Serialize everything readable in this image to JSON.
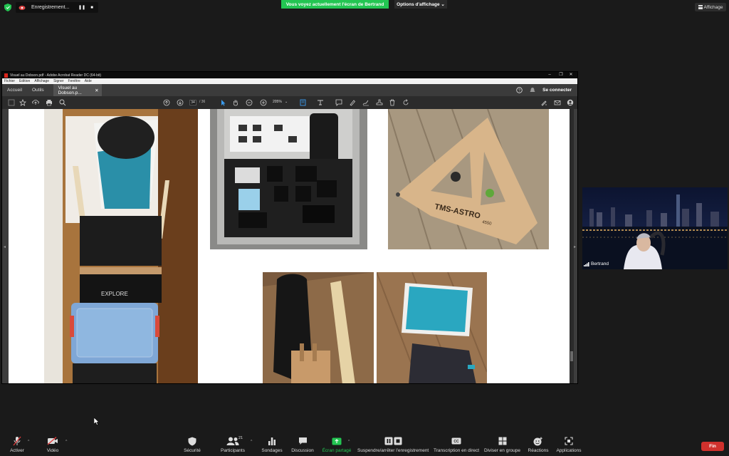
{
  "zoom_header": {
    "recording_label": "Enregistrement...",
    "share_banner": "Vous voyez actuellement l'écran de Bertrand",
    "view_options": "Options d'affichage",
    "view_button": "Affichage"
  },
  "acrobat": {
    "window_title": "Visuel au Dobson.pdf - Adobe Acrobat Reader DC (64-bit)",
    "menu": [
      "Fichier",
      "Edition",
      "Affichage",
      "Signer",
      "Fenêtre",
      "Aide"
    ],
    "tabs": {
      "home": "Accueil",
      "tools": "Outils",
      "doc": "Visuel au Dobson.p..."
    },
    "sign_in": "Se connecter",
    "page_current": "34",
    "page_total": "/ 36",
    "zoom": "205%",
    "photo_text": {
      "explore": "EXPLORE",
      "tms": "TMS-ASTRO",
      "tms_sub": "4550"
    }
  },
  "participant": {
    "name": "Bertrand"
  },
  "toolbar": {
    "activer": "Activer",
    "video": "Vidéo",
    "securite": "Sécurité",
    "participants": "Participants",
    "participant_count": "21",
    "sondages": "Sondages",
    "discussion": "Discussion",
    "ecran_partage": "Écran partagé",
    "suspendre": "Suspendre/arrêter l'enregistrement",
    "transcription": "Transcription en direct",
    "diviser": "Diviser en groupe",
    "reactions": "Réactions",
    "applications": "Applications",
    "fin": "Fin"
  },
  "colors": {
    "share_green": "#23c552",
    "end_red": "#d0312d",
    "accent_blue": "#3a9cf0"
  }
}
